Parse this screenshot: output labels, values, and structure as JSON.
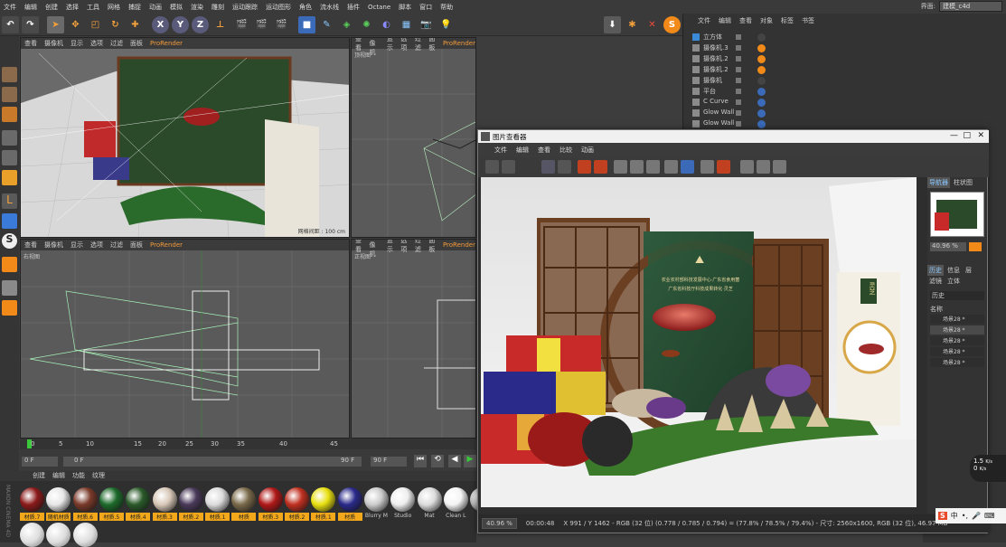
{
  "menu": [
    "文件",
    "编辑",
    "创建",
    "选择",
    "工具",
    "网格",
    "捕捉",
    "动画",
    "模拟",
    "渲染",
    "雕刻",
    "运动跟踪",
    "运动图形",
    "角色",
    "流水线",
    "插件",
    "Octane",
    "脚本",
    "窗口",
    "帮助"
  ],
  "interface": {
    "label": "界面:",
    "value": "建模_c4d"
  },
  "viewport_menu": [
    "查看",
    "摄像机",
    "显示",
    "选项",
    "过滤",
    "面板"
  ],
  "prorender": "ProRender",
  "viewports": {
    "persp": "",
    "top": "顶视图",
    "right": "右视图",
    "front": "正视图"
  },
  "grid_label": "网格间距 : 100 cm",
  "timeline": {
    "ticks": [
      "0",
      "5",
      "10",
      "15",
      "20",
      "25",
      "30",
      "35",
      "40",
      "45"
    ],
    "start": "0 F",
    "cur": "0 F",
    "end": "90 F",
    "end2": "90 F"
  },
  "materials": [
    {
      "label": "材质.7",
      "color": "#8b1a1a"
    },
    {
      "label": "随机材质",
      "color": "#e8e8e8"
    },
    {
      "label": "材质.6",
      "color": "#7a3a2a"
    },
    {
      "label": "材质.5",
      "color": "#1d6a2a"
    },
    {
      "label": "材质.4",
      "color": "#2a5a2a"
    },
    {
      "label": "材质.3",
      "color": "#d8c8b8"
    },
    {
      "label": "材质.2",
      "color": "#4a3a5a"
    },
    {
      "label": "材质.1",
      "color": "#dcdcdc"
    },
    {
      "label": "材质",
      "color": "#7a6a4a"
    },
    {
      "label": "材质.3",
      "color": "#b01818"
    },
    {
      "label": "材质.2",
      "color": "#c03020"
    },
    {
      "label": "材质.1",
      "color": "#e8e010"
    },
    {
      "label": "材质",
      "color": "#2a2a8a"
    },
    {
      "label": "Blurry M",
      "color": "#cccccc"
    },
    {
      "label": "Studio",
      "color": "#eeeeee"
    },
    {
      "label": "Mat",
      "color": "#dddddd"
    },
    {
      "label": "Clean L",
      "color": "#f4f4f4"
    },
    {
      "label": "M",
      "color": "#bbbbbb"
    }
  ],
  "object_menu": [
    "文件",
    "编辑",
    "查看",
    "对象",
    "标签",
    "书签"
  ],
  "objects": [
    "立方体",
    "摄像机.3",
    "摄像机.2",
    "摄像机.2",
    "摄像机",
    "平台",
    "C Curve",
    "Glow Wall",
    "Glow Wall"
  ],
  "picture_viewer": {
    "title": "图片查看器",
    "menu": [
      "文件",
      "编辑",
      "查看",
      "比较",
      "动画"
    ],
    "zoom": "40.96 %",
    "time": "00:00:48",
    "status": "X 991 / Y 1462 - RGB (32 位) (0.778 / 0.785 / 0.794) = (77.8% / 78.5% / 79.4%) - 尺寸: 2560x1600, RGB (32 位), 46.97 MB"
  },
  "side": {
    "tabs": [
      "导航器",
      "柱状图"
    ],
    "zoom": "40.96 %",
    "tabs2": [
      "历史",
      "信息",
      "层"
    ],
    "tabs3": [
      "滤镜",
      "立体"
    ],
    "history": "历史",
    "name_col": "名称",
    "items": [
      "场景28 *",
      "场景28 *",
      "场景28 *",
      "场景28 *",
      "场景28 *"
    ]
  },
  "render_text": {
    "brand_cn": "灵芝",
    "line1": "农业农村部科技发展中心·广东省食用菌",
    "line2": "广东省科技厅科技成果转化·灵芝"
  },
  "net": {
    "up": "1.5",
    "up_unit": "K/s",
    "down": "0",
    "down_unit": "K/s"
  },
  "ime": "中"
}
